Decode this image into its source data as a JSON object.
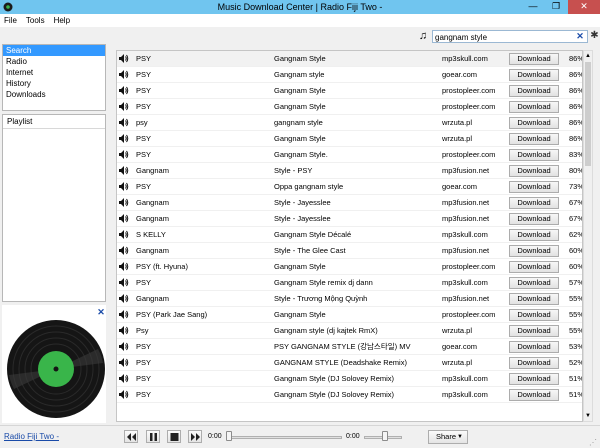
{
  "window": {
    "title": "Music Download Center | Radio Fiji Two -",
    "minimize_glyph": "—",
    "maximize_glyph": "❐",
    "close_glyph": "✕"
  },
  "menu": [
    {
      "label": "File"
    },
    {
      "label": "Tools"
    },
    {
      "label": "Help"
    }
  ],
  "search": {
    "value": "gangnam style",
    "note_icon": "music-note-icon",
    "note_glyph": "♫",
    "clear_glyph": "✕",
    "options_glyph": "✱"
  },
  "nav": [
    {
      "label": "Search",
      "selected": true
    },
    {
      "label": "Radio",
      "selected": false
    },
    {
      "label": "Internet",
      "selected": false
    },
    {
      "label": "History",
      "selected": false
    },
    {
      "label": "Downloads",
      "selected": false
    }
  ],
  "playlist": {
    "header": "Playlist"
  },
  "disc_panel": {
    "close_glyph": "✕",
    "accent": "#39b54a"
  },
  "results": {
    "download_label": "Download",
    "rows": [
      {
        "artist": "PSY",
        "title": "Gangnam Style",
        "site": "mp3skull.com",
        "match": "86%"
      },
      {
        "artist": "PSY",
        "title": "Gangnam style",
        "site": "goear.com",
        "match": "86%"
      },
      {
        "artist": "PSY",
        "title": "Gangnam Style",
        "site": "prostopleer.com",
        "match": "86%"
      },
      {
        "artist": "PSY",
        "title": "Gangnam Style",
        "site": "prostopleer.com",
        "match": "86%"
      },
      {
        "artist": "psy",
        "title": "gangnam style",
        "site": "wrzuta.pl",
        "match": "86%"
      },
      {
        "artist": "PSY",
        "title": "Gangnam Style",
        "site": "wrzuta.pl",
        "match": "86%"
      },
      {
        "artist": "PSY",
        "title": "Gangnam Style.",
        "site": "prostopleer.com",
        "match": "83%"
      },
      {
        "artist": "Gangnam",
        "title": "Style - PSY",
        "site": "mp3fusion.net",
        "match": "80%"
      },
      {
        "artist": "PSY",
        "title": "Oppa gangnam style",
        "site": "goear.com",
        "match": "73%"
      },
      {
        "artist": "Gangnam",
        "title": "Style - Jayesslee",
        "site": "mp3fusion.net",
        "match": "67%"
      },
      {
        "artist": "Gangnam",
        "title": "Style - Jayesslee",
        "site": "mp3fusion.net",
        "match": "67%"
      },
      {
        "artist": "S KELLY",
        "title": "Gangnam Style Décalé",
        "site": "mp3skull.com",
        "match": "62%"
      },
      {
        "artist": "Gangnam",
        "title": "Style - The Glee Cast",
        "site": "mp3fusion.net",
        "match": "60%"
      },
      {
        "artist": "PSY (ft. Hyuna)",
        "title": "Gangnam Style",
        "site": "prostopleer.com",
        "match": "60%"
      },
      {
        "artist": "PSY",
        "title": "Gangnam Style remix dj dann",
        "site": "mp3skull.com",
        "match": "57%"
      },
      {
        "artist": "Gangnam",
        "title": "Style - Trương Mộng Quỳnh",
        "site": "mp3fusion.net",
        "match": "55%"
      },
      {
        "artist": "PSY (Park Jae Sang)",
        "title": "Gangnam Style",
        "site": "prostopleer.com",
        "match": "55%"
      },
      {
        "artist": "Psy",
        "title": "Gangnam style (dj kajtek RmX)",
        "site": "wrzuta.pl",
        "match": "55%"
      },
      {
        "artist": "PSY",
        "title": "PSY    GANGNAM STYLE (강남스타일) MV",
        "site": "goear.com",
        "match": "53%"
      },
      {
        "artist": "PSY",
        "title": "GANGNAM STYLE (Deadshake Remix)",
        "site": "wrzuta.pl",
        "match": "52%"
      },
      {
        "artist": "PSY",
        "title": "Gangnam Style (DJ Solovey Remix)",
        "site": "mp3skull.com",
        "match": "51%"
      },
      {
        "artist": "PSY",
        "title": "Gangnam Style (DJ Solovey Remix)",
        "site": "mp3skull.com",
        "match": "51%"
      }
    ]
  },
  "player": {
    "station_link": "Radio Fiji Two -",
    "elapsed": "0:00",
    "remaining": "0:00",
    "progress": 0,
    "volume": 0.55,
    "share_label": "Share",
    "share_caret": "▼",
    "grip_glyph": "⋰"
  }
}
